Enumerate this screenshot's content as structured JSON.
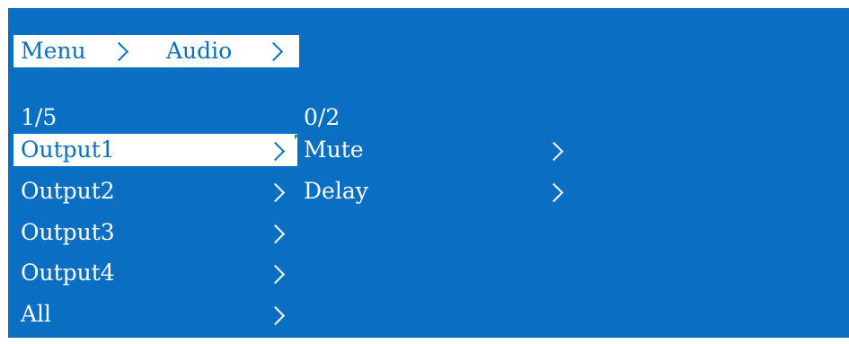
{
  "breadcrumb": {
    "items": [
      "Menu",
      "Audio"
    ]
  },
  "left_panel": {
    "counter": "1/5",
    "items": [
      "Output1",
      "Output2",
      "Output3",
      "Output4",
      "All"
    ],
    "selected_index": 0
  },
  "right_panel": {
    "counter": "0/2",
    "items": [
      "Mute",
      "Delay"
    ]
  },
  "colors": {
    "background": "#0a6fc2",
    "highlight": "#ffffff",
    "text": "#ffffff",
    "highlight_text": "#0a6fc2",
    "cursor_mark": "#1f9a4a"
  },
  "icons": {
    "item_arrow": "chevron-right-icon"
  }
}
